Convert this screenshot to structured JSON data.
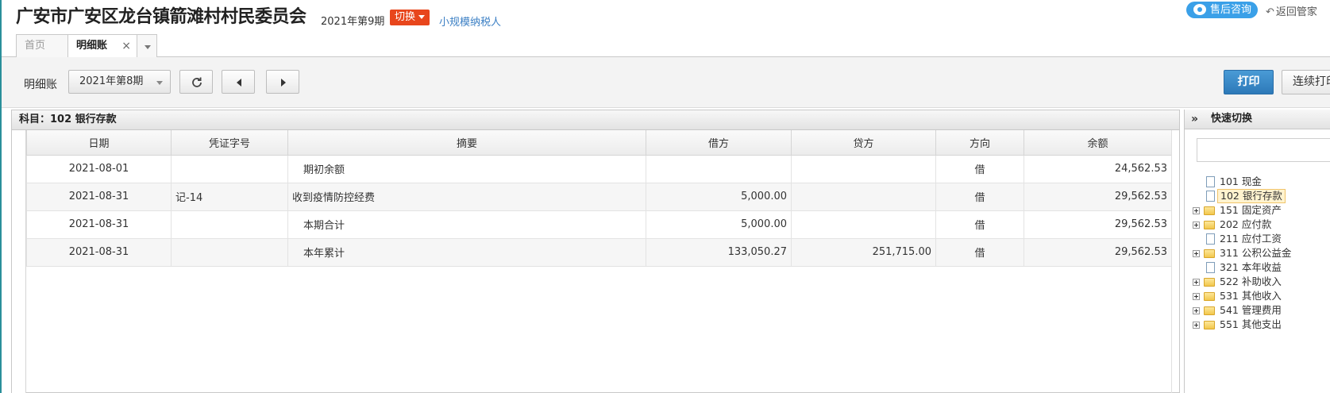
{
  "header": {
    "org_name": "广安市广安区龙台镇箭滩村村民委员会",
    "period": "2021年第9期",
    "switch_label": "切换",
    "taxpayer_type": "小规模纳税人",
    "support_label": "售后咨询",
    "back_label": "返回管家"
  },
  "tabs": {
    "home": "首页",
    "active": "明细账",
    "close": "×"
  },
  "toolbar": {
    "label": "明细账",
    "period_select": "2021年第8期",
    "print_label": "打印",
    "continuous_print_label": "连续打印"
  },
  "ledger": {
    "subject_title": "科目：102  银行存款",
    "columns": [
      "日期",
      "凭证字号",
      "摘要",
      "借方",
      "贷方",
      "方向",
      "余额"
    ],
    "rows": [
      {
        "date": "2021-08-01",
        "voucher": "",
        "summary": "期初余额",
        "debit": "",
        "credit": "",
        "direction": "借",
        "balance": "24,562.53"
      },
      {
        "date": "2021-08-31",
        "voucher": "记-14",
        "summary": "收到疫情防控经费",
        "debit": "5,000.00",
        "credit": "",
        "direction": "借",
        "balance": "29,562.53"
      },
      {
        "date": "2021-08-31",
        "voucher": "",
        "summary": "本期合计",
        "debit": "5,000.00",
        "credit": "",
        "direction": "借",
        "balance": "29,562.53"
      },
      {
        "date": "2021-08-31",
        "voucher": "",
        "summary": "本年累计",
        "debit": "133,050.27",
        "credit": "251,715.00",
        "direction": "借",
        "balance": "29,562.53"
      }
    ]
  },
  "quick_switch": {
    "title": "快速切换",
    "collapse_glyph": "»",
    "items": [
      {
        "label": "101 现金",
        "kind": "file",
        "expandable": false,
        "selected": false
      },
      {
        "label": "102 银行存款",
        "kind": "file",
        "expandable": false,
        "selected": true
      },
      {
        "label": "151 固定资产",
        "kind": "folder",
        "expandable": true,
        "selected": false
      },
      {
        "label": "202 应付款",
        "kind": "folder",
        "expandable": true,
        "selected": false
      },
      {
        "label": "211 应付工资",
        "kind": "file",
        "expandable": false,
        "selected": false
      },
      {
        "label": "311 公积公益金",
        "kind": "folder",
        "expandable": true,
        "selected": false
      },
      {
        "label": "321 本年收益",
        "kind": "file",
        "expandable": false,
        "selected": false
      },
      {
        "label": "522 补助收入",
        "kind": "folder",
        "expandable": true,
        "selected": false
      },
      {
        "label": "531 其他收入",
        "kind": "folder",
        "expandable": true,
        "selected": false
      },
      {
        "label": "541 管理费用",
        "kind": "folder",
        "expandable": true,
        "selected": false
      },
      {
        "label": "551 其他支出",
        "kind": "folder",
        "expandable": true,
        "selected": false
      }
    ]
  },
  "colors": {
    "switch_bg": "#e8461c",
    "link": "#3b7fc4",
    "support_bg": "#3aa0e8",
    "print_bg": "#2d79b8",
    "selected_bg": "#fff3cf"
  }
}
